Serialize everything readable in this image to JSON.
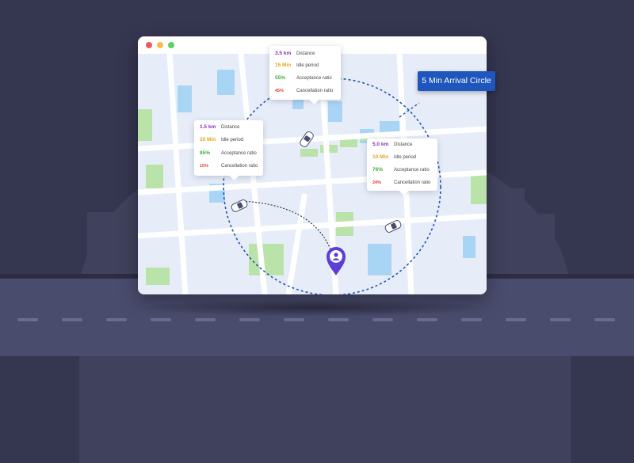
{
  "window": {
    "controls": [
      "close",
      "minimize",
      "maximize"
    ],
    "control_colors": [
      "#ee5a5a",
      "#f5c04a",
      "#5fcf62"
    ]
  },
  "arrival_badge": {
    "label": "5 Min Arrival Circle"
  },
  "metric_cards": [
    {
      "id": "top",
      "rows": [
        {
          "value": "3.5 km",
          "label": "Distance",
          "color": "#8a2bb8"
        },
        {
          "value": "15 Min",
          "label": "Idle period",
          "color": "#e8a317"
        },
        {
          "value": "55%",
          "label": "Acceptance ratio",
          "color": "#3fae3f"
        },
        {
          "value": "45%",
          "label": "Cancellation ratio",
          "color": "#e53935"
        }
      ]
    },
    {
      "id": "left",
      "rows": [
        {
          "value": "1.5 km",
          "label": "Distance",
          "color": "#8a2bb8"
        },
        {
          "value": "20 Min",
          "label": "Idle period",
          "color": "#e8a317"
        },
        {
          "value": "85%",
          "label": "Acceptance ratio",
          "color": "#3fae3f"
        },
        {
          "value": "15%",
          "label": "Cancellation ratio",
          "color": "#e53935"
        }
      ]
    },
    {
      "id": "right",
      "rows": [
        {
          "value": "5.0 km",
          "label": "Distance",
          "color": "#8a2bb8"
        },
        {
          "value": "10 Min",
          "label": "Idle period",
          "color": "#e8a317"
        },
        {
          "value": "76%",
          "label": "Acceptance ratio",
          "color": "#3fae3f"
        },
        {
          "value": "24%",
          "label": "Cancellation ratio",
          "color": "#e53935"
        }
      ]
    }
  ],
  "map": {
    "icons": [
      "car-icon",
      "car-icon",
      "car-icon",
      "user-location-pin-icon"
    ],
    "colors": {
      "land": "#e7edf8",
      "road": "#ffffff",
      "water": "#a9d5f5",
      "park": "#b9e3a8",
      "circle": "#1f56bd",
      "pin": "#5b3fd6"
    }
  }
}
